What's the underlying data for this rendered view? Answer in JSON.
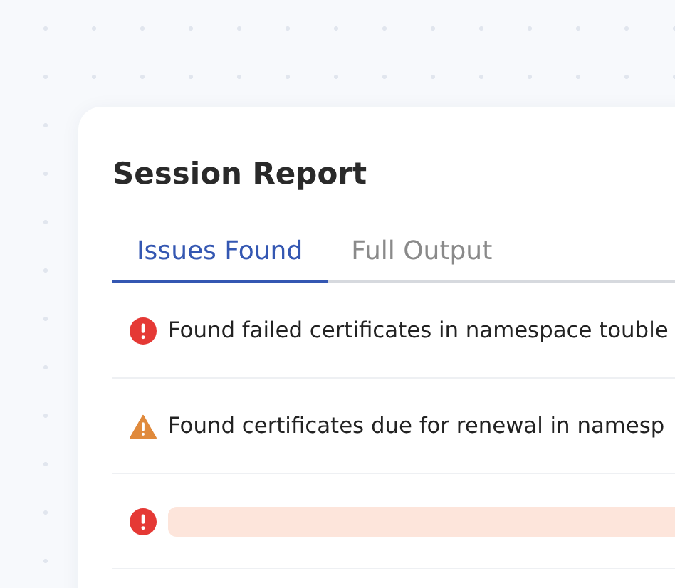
{
  "card": {
    "title": "Session Report",
    "tabs": [
      {
        "label": "Issues Found",
        "selected": true
      },
      {
        "label": "Full Output",
        "selected": false
      }
    ],
    "issues": [
      {
        "kind": "error",
        "message": "Found failed certificates in namespace touble"
      },
      {
        "kind": "warning",
        "message": "Found certificates due for renewal in namesp"
      },
      {
        "kind": "error",
        "loading": true
      }
    ]
  }
}
